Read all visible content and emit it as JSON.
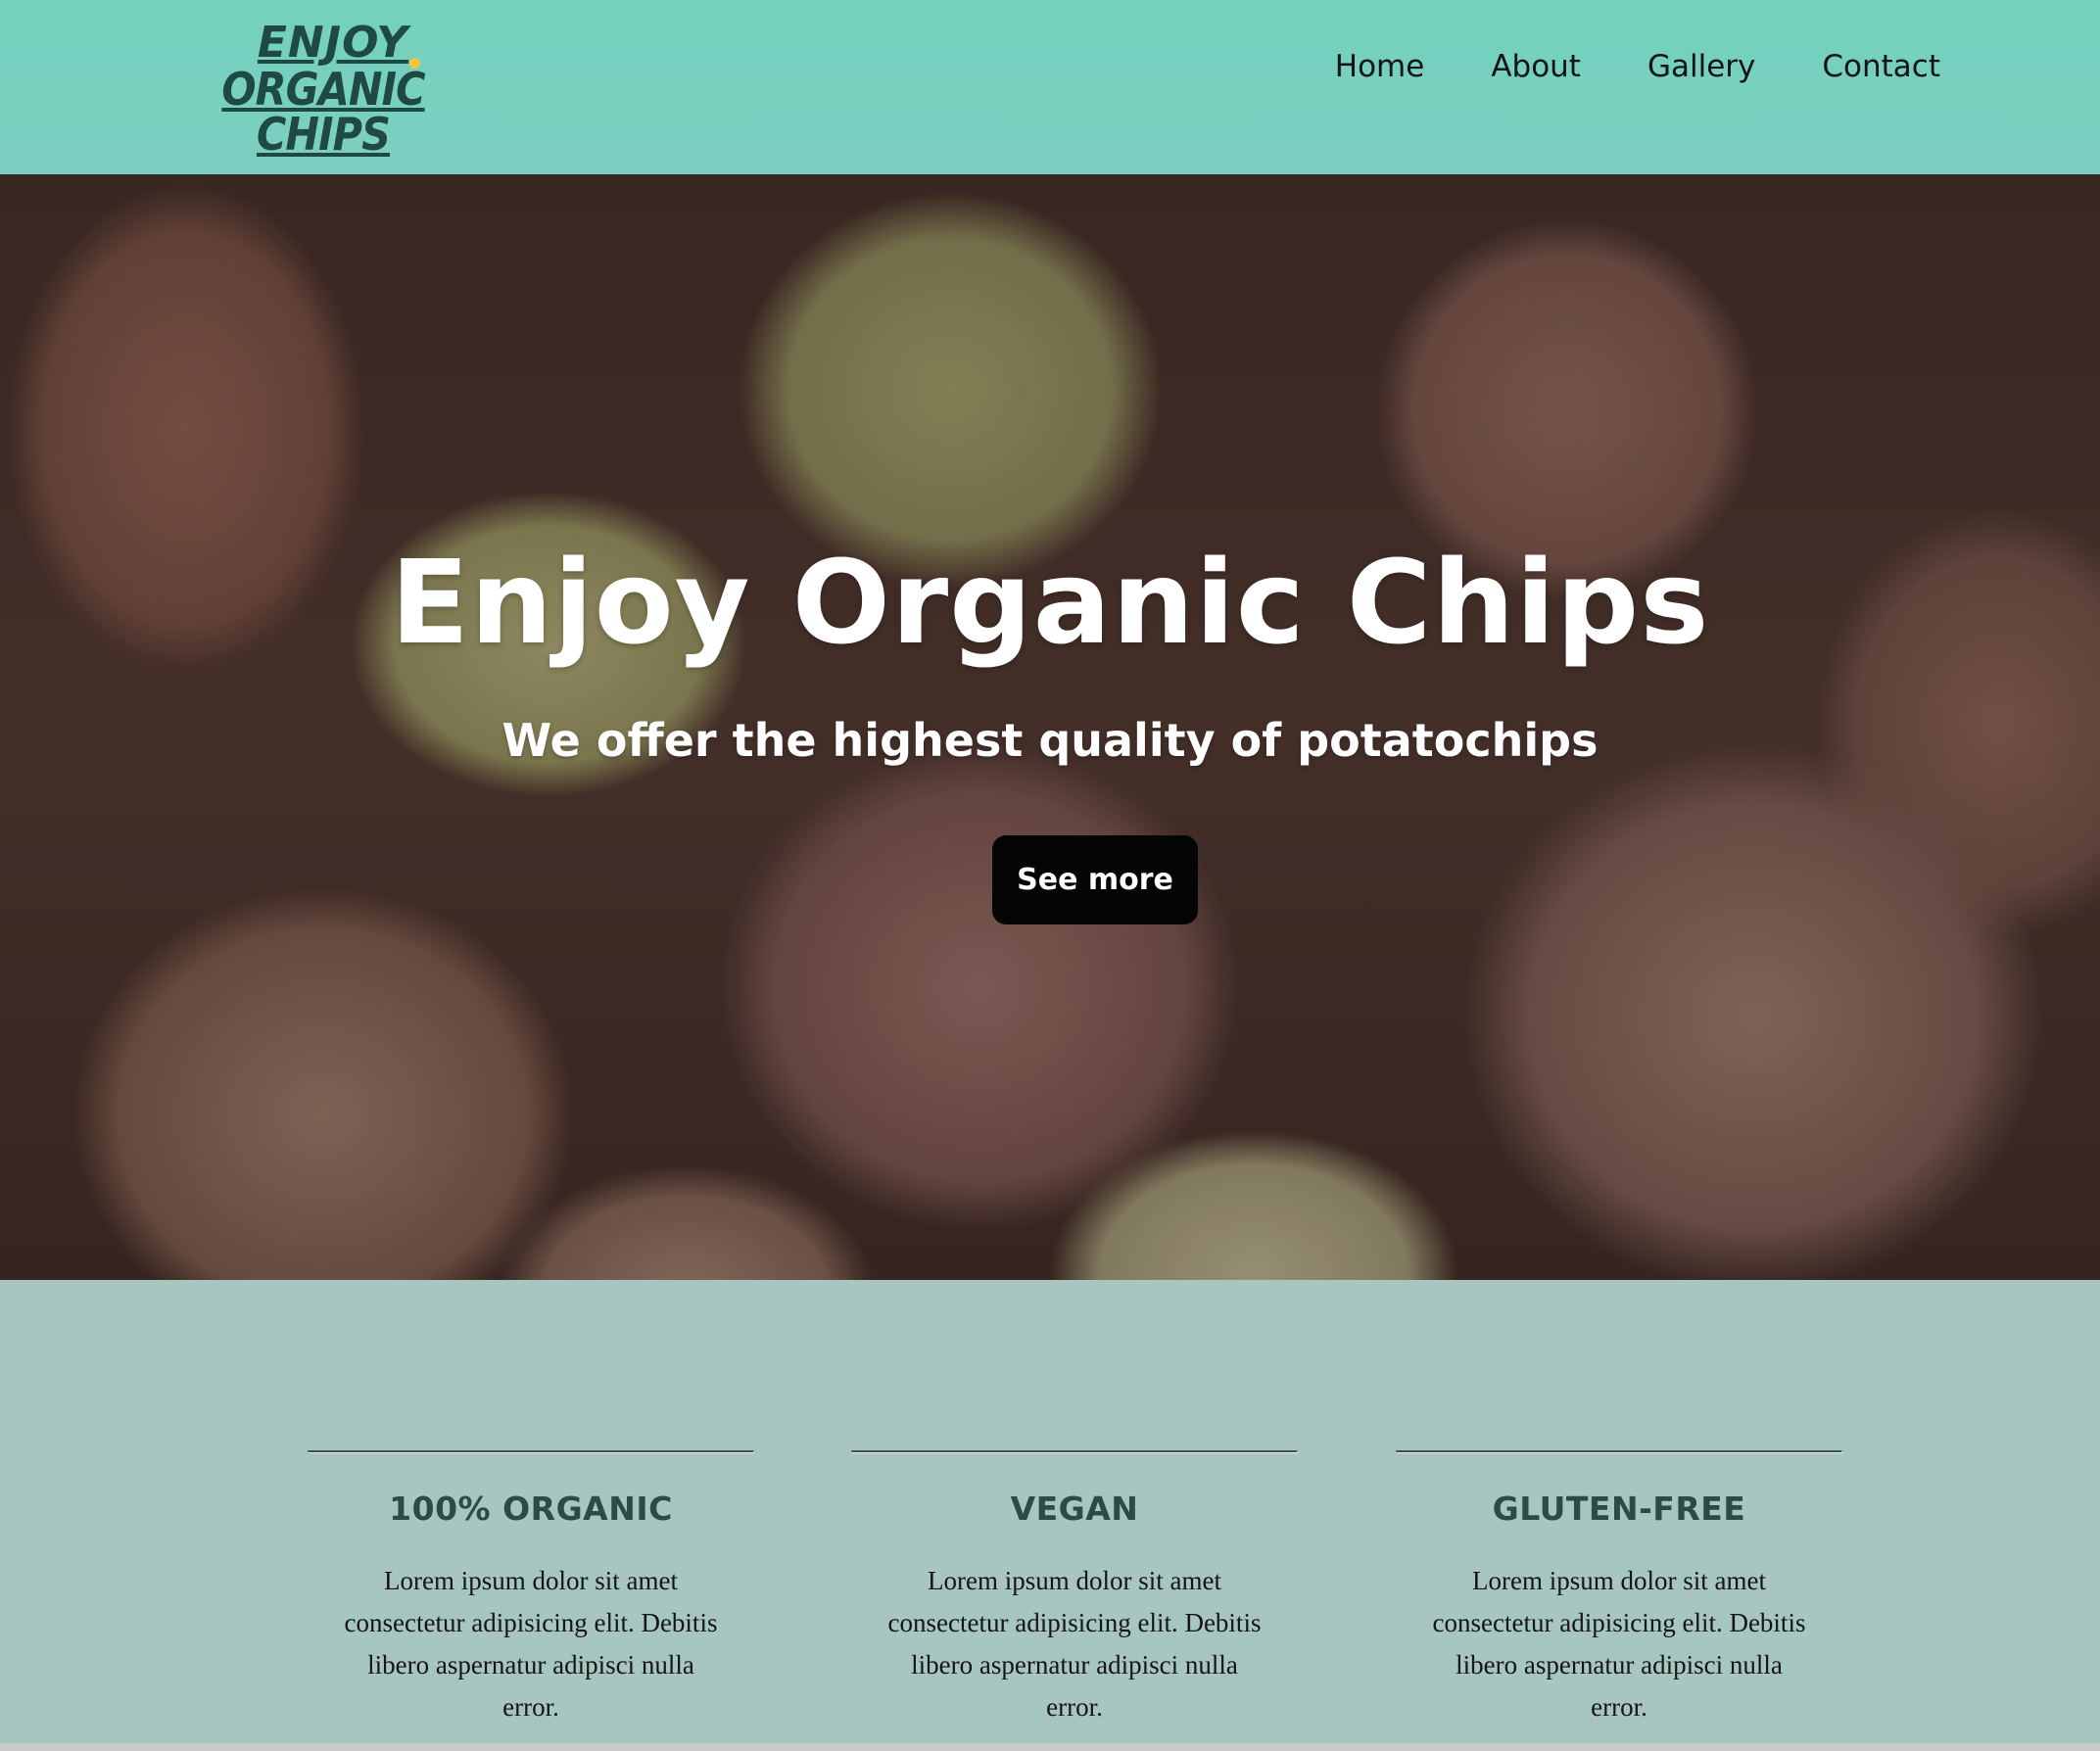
{
  "header": {
    "logo": {
      "line1": "ENJOY",
      "line2": "ORGANIC CHIPS",
      "dot_color": "#f2c53d"
    },
    "nav": [
      {
        "label": "Home"
      },
      {
        "label": "About"
      },
      {
        "label": "Gallery"
      },
      {
        "label": "Contact"
      }
    ],
    "background_color": "#73d1be"
  },
  "hero": {
    "title": "Enjoy Organic Chips",
    "subtitle": "We offer the highest quality of potatochips",
    "button_label": "See more",
    "button_color": "#050505",
    "background_image": "close-up photo of red and yellow potatoes"
  },
  "features": {
    "background_color": "#a6c6bf",
    "items": [
      {
        "title": "100% ORGANIC",
        "text": "Lorem ipsum dolor sit amet consectetur adipisicing elit. Debitis libero aspernatur adipisci nulla error."
      },
      {
        "title": "VEGAN",
        "text": "Lorem ipsum dolor sit amet consectetur adipisicing elit. Debitis libero aspernatur adipisci nulla error."
      },
      {
        "title": "GLUTEN-FREE",
        "text": "Lorem ipsum dolor sit amet consectetur adipisicing elit. Debitis libero aspernatur adipisci nulla error."
      }
    ]
  }
}
